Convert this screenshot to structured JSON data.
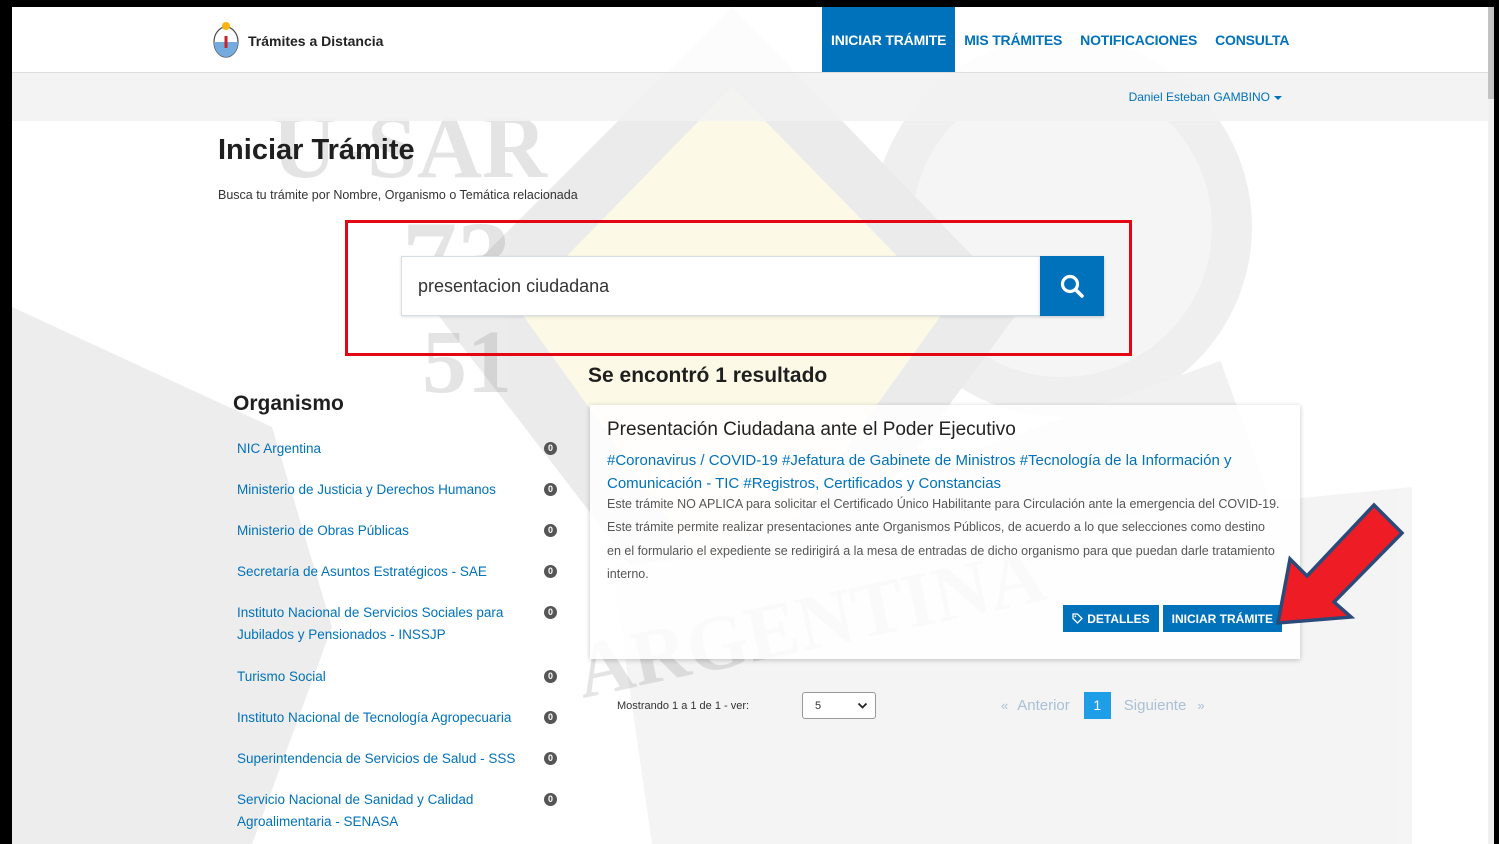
{
  "header": {
    "brand": "Trámites a Distancia",
    "nav": [
      "INICIAR TRÁMITE",
      "MIS TRÁMITES",
      "NOTIFICACIONES",
      "CONSULTA"
    ],
    "user": "Daniel Esteban GAMBINO"
  },
  "page": {
    "title": "Iniciar Trámite",
    "subtitle": "Busca tu trámite por Nombre, Organismo o Temática relacionada"
  },
  "search": {
    "value": "presentacion ciudadana"
  },
  "results": {
    "title": "Se encontró 1 resultado",
    "item": {
      "title": "Presentación Ciudadana ante el Poder Ejecutivo",
      "tags": "#Coronavirus / COVID-19 #Jefatura de Gabinete de Ministros #Tecnología de la Información y Comunicación - TIC #Registros, Certificados y Constancias",
      "description": "Este trámite NO APLICA para solicitar el Certificado Único Habilitante para Circulación ante la emergencia del COVID-19. Este trámite permite realizar presentaciones ante Organismos Públicos, de acuerdo a lo que selecciones como destino en el formulario el expediente se redirigirá a la mesa de entradas de dicho organismo para que puedan darle tratamiento interno.",
      "details_label": "DETALLES",
      "start_label": "INICIAR TRÁMITE"
    }
  },
  "sidebar": {
    "title": "Organismo",
    "items": [
      {
        "label": "NIC Argentina",
        "count": "0"
      },
      {
        "label": "Ministerio de Justicia y Derechos Humanos",
        "count": "0"
      },
      {
        "label": "Ministerio de Obras Públicas",
        "count": "0"
      },
      {
        "label": "Secretaría de Asuntos Estratégicos - SAE",
        "count": "0"
      },
      {
        "label": "Instituto Nacional de Servicios Sociales para Jubilados y Pensionados - INSSJP",
        "count": "0"
      },
      {
        "label": "Turismo Social",
        "count": "0"
      },
      {
        "label": "Instituto Nacional de Tecnología Agropecuaria",
        "count": "0"
      },
      {
        "label": "Superintendencia de Servicios de Salud - SSS",
        "count": "0"
      },
      {
        "label": "Servicio Nacional de Sanidad y Calidad Agroalimentaria - SENASA",
        "count": "0"
      }
    ]
  },
  "pager": {
    "showing": "Mostrando 1 a 1 de 1 - ver:",
    "page_size": "5",
    "prev_symbol": "«",
    "prev": "Anterior",
    "current": "1",
    "next": "Siguiente",
    "next_symbol": "»"
  },
  "colors": {
    "primary": "#0072bb",
    "highlight_border": "#e30613",
    "arrow_fill": "#ee1c24",
    "arrow_outline": "#2b4a7a"
  },
  "icons": {
    "brand": "argentina-coat-of-arms-icon",
    "search": "magnifier-icon",
    "details": "tag-icon",
    "annotation": "red-arrow-icon"
  }
}
